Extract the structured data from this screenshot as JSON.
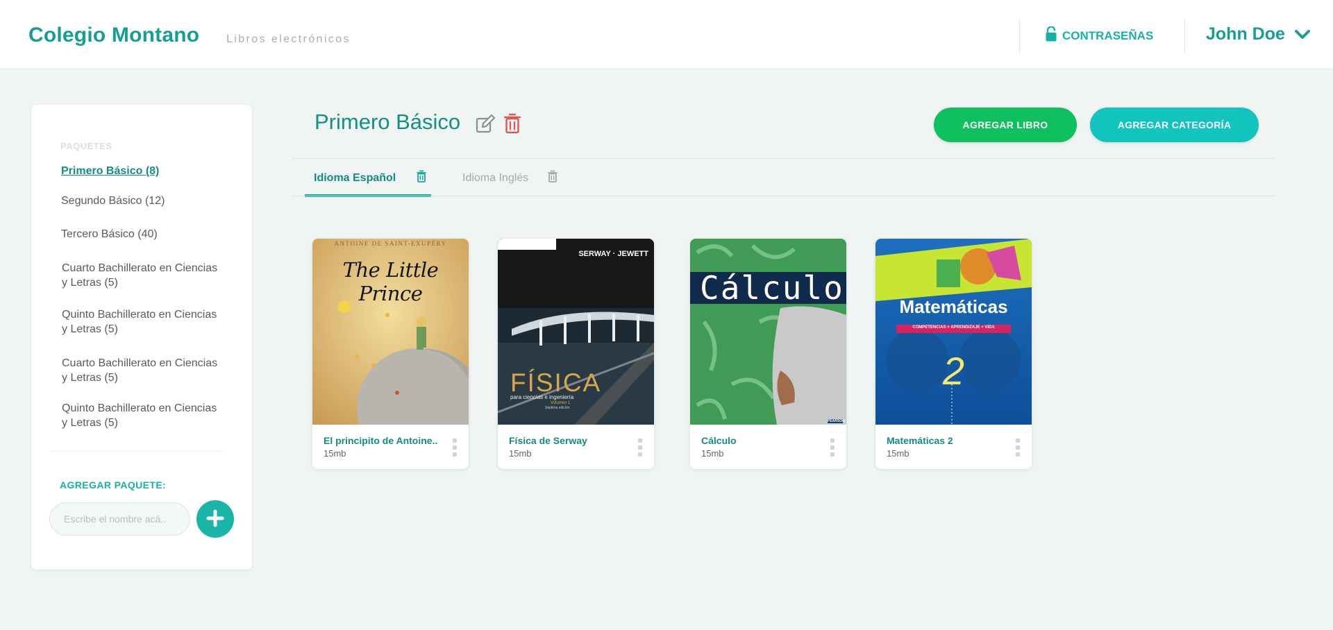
{
  "header": {
    "brand": "Colegio Montano",
    "subtitle": "Libros electrónicos",
    "passwords_label": "CONTRASEÑAS",
    "user_name": "John Doe",
    "icons": [
      "lock-open-icon",
      "chevron-down-icon"
    ]
  },
  "sidebar": {
    "heading": "PAQUETES",
    "packages": [
      {
        "label": "Primero Básico (8)",
        "active": true
      },
      {
        "label": "Segundo Básico (12)",
        "active": false
      },
      {
        "label": "Tercero Básico (40)",
        "active": false
      },
      {
        "label": "Cuarto Bachillerato en Ciencias\n y Letras (5)",
        "active": false
      },
      {
        "label": "Quinto Bachillerato en Ciencias\ny Letras (5)",
        "active": false
      },
      {
        "label": "Cuarto Bachillerato en Ciencias\ny Letras (5)",
        "active": false
      },
      {
        "label": "Quinto Bachillerato en Ciencias\ny Letras (5)",
        "active": false
      }
    ],
    "add_label": "AGREGAR PAQUETE:",
    "add_placeholder": "Escribe el nombre acá..",
    "add_icon": "plus-icon"
  },
  "main": {
    "title": "Primero Básico",
    "title_icons": [
      "edit-icon",
      "trash-icon"
    ],
    "add_book_label": "AGREGAR LIBRO",
    "add_category_label": "AGREGAR CATEGORÍA",
    "tabs": [
      {
        "label": "Idioma Español",
        "active": true
      },
      {
        "label": "Idioma Inglés",
        "active": false
      }
    ],
    "books": [
      {
        "title": "El principito de Antoine..",
        "size": "15mb",
        "cover": {
          "top": "ANTOINE DE SAINT-EXUPÉRY",
          "title": "The Little Prince"
        }
      },
      {
        "title": "Física de Serway",
        "size": "15mb",
        "cover": {
          "authors": "SERWAY · JEWETT",
          "title": "FÍSICA",
          "sub": "para ciencias e ingeniería",
          "sub2": "Volumen 1",
          "sub3": "Séptima edición"
        }
      },
      {
        "title": "Cálculo",
        "size": "15mb",
        "cover": {
          "title": "Cálculo",
          "publisher": "PEARSON"
        }
      },
      {
        "title": "Matemáticas 2",
        "size": "15mb",
        "cover": {
          "title": "Matemáticas",
          "band": "COMPETENCIAS + APRENDIZAJE + VIDA",
          "number": "2"
        }
      }
    ]
  },
  "colors": {
    "primary": "#159f93",
    "accent": "#16b1a6",
    "green_button": "#0ec15e",
    "teal_button": "#12c4be",
    "danger": "#e0574f",
    "background": "#f0f5f4"
  }
}
